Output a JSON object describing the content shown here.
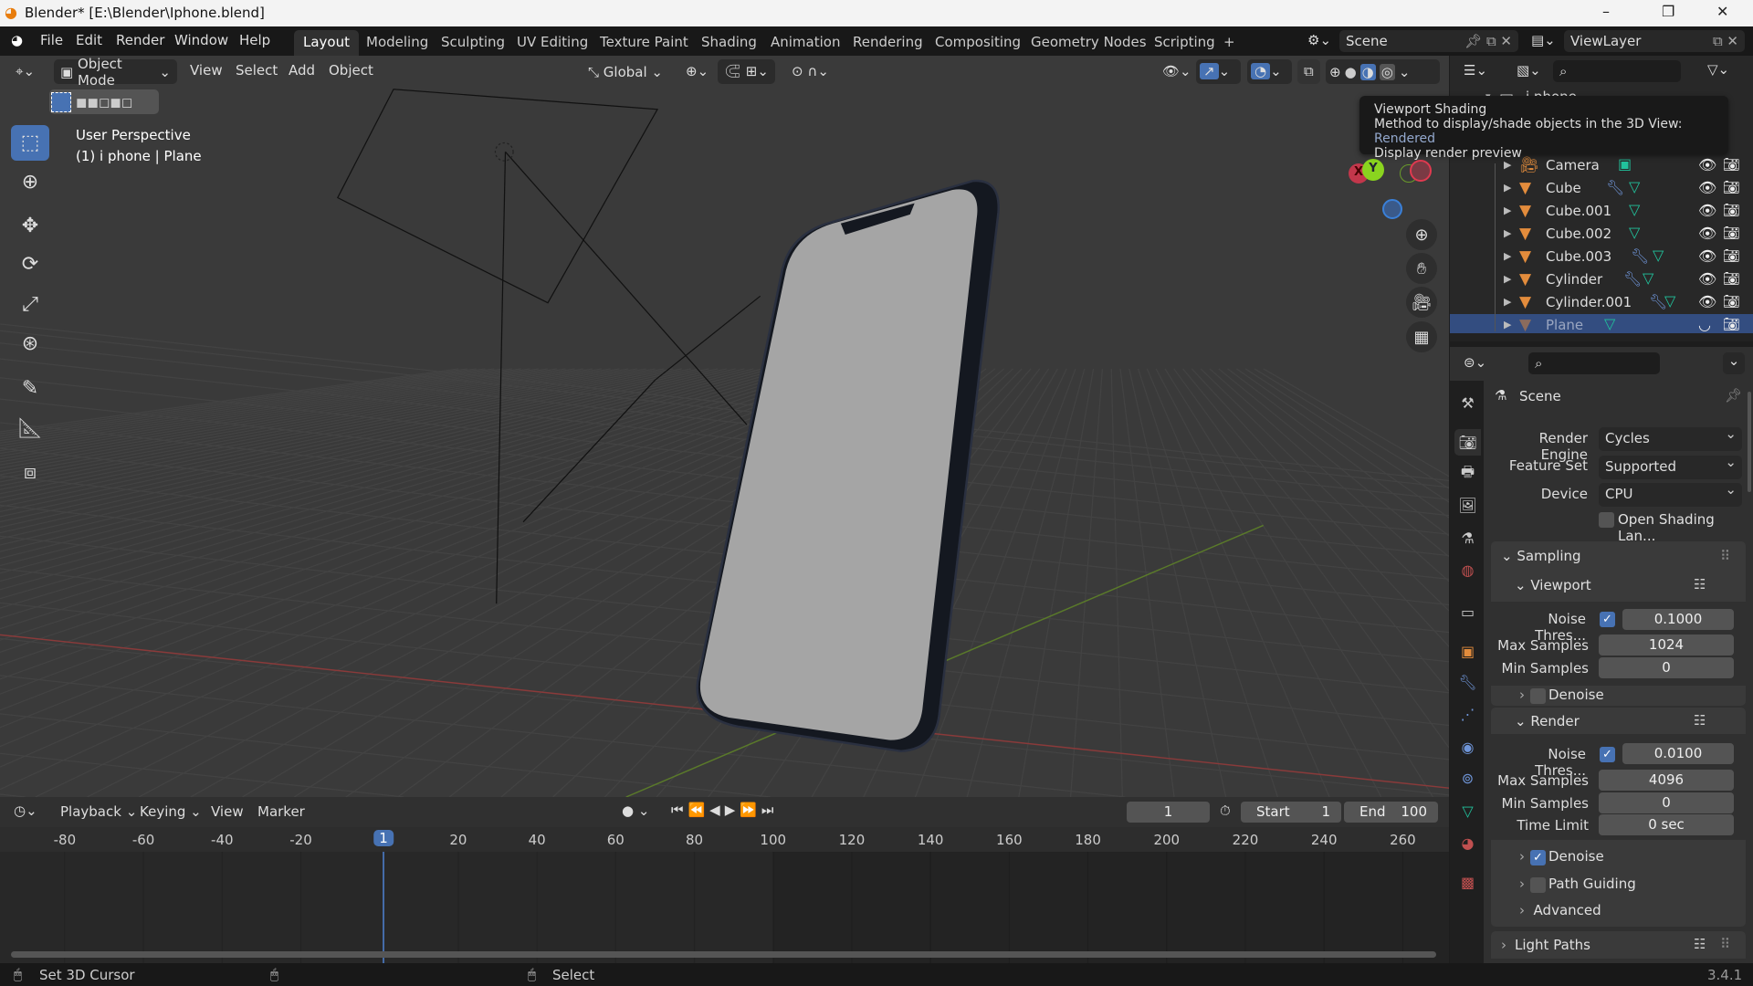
{
  "window": {
    "title": "Blender* [E:\\Blender\\Iphone.blend]",
    "minimize": "–",
    "maximize": "❐",
    "close": "✕"
  },
  "menu": [
    "File",
    "Edit",
    "Render",
    "Window",
    "Help"
  ],
  "workspaces": [
    {
      "label": "Layout",
      "active": true
    },
    {
      "label": "Modeling"
    },
    {
      "label": "Sculpting"
    },
    {
      "label": "UV Editing"
    },
    {
      "label": "Texture Paint"
    },
    {
      "label": "Shading"
    },
    {
      "label": "Animation"
    },
    {
      "label": "Rendering"
    },
    {
      "label": "Compositing"
    },
    {
      "label": "Geometry Nodes"
    },
    {
      "label": "Scripting"
    }
  ],
  "add_workspace": "+",
  "scene": {
    "name": "Scene",
    "view_layer": "ViewLayer"
  },
  "viewport": {
    "mode": "Object Mode",
    "menus": [
      "View",
      "Select",
      "Add",
      "Object"
    ],
    "orientation": "Global",
    "overlay_text": [
      "User Perspective",
      "(1) i phone | Plane"
    ],
    "shading_active": "rendered",
    "gizmo": {
      "x": "X",
      "y": "Y"
    }
  },
  "tooltip": {
    "title": "Viewport Shading",
    "desc": "Method to display/shade objects in the 3D View:",
    "value": "Rendered",
    "detail": "Display render preview"
  },
  "outliner": {
    "collection": "i phone",
    "items": [
      {
        "name": "Camera",
        "type": "camera"
      },
      {
        "name": "Cube",
        "modifier": true
      },
      {
        "name": "Cube.001"
      },
      {
        "name": "Cube.002"
      },
      {
        "name": "Cube.003",
        "modifier": true
      },
      {
        "name": "Cylinder",
        "modifier": true
      },
      {
        "name": "Cylinder.001",
        "modifier": true
      },
      {
        "name": "Plane",
        "selected": true
      }
    ]
  },
  "properties": {
    "context": "Scene",
    "render_engine": {
      "label": "Render Engine",
      "value": "Cycles"
    },
    "feature_set": {
      "label": "Feature Set",
      "value": "Supported"
    },
    "device": {
      "label": "Device",
      "value": "CPU"
    },
    "osl": {
      "label": "Open Shading Lan...",
      "checked": false
    },
    "sampling": {
      "label": "Sampling",
      "viewport": {
        "label": "Viewport",
        "noise_label": "Noise Thres...",
        "noise_checked": true,
        "noise": "0.1000",
        "max_label": "Max Samples",
        "max": "1024",
        "min_label": "Min Samples",
        "min": "0",
        "denoise_label": "Denoise",
        "denoise": false
      },
      "render": {
        "label": "Render",
        "noise_label": "Noise Thres...",
        "noise_checked": true,
        "noise": "0.0100",
        "max_label": "Max Samples",
        "max": "4096",
        "min_label": "Min Samples",
        "min": "0",
        "time_label": "Time Limit",
        "time": "0 sec",
        "denoise_label": "Denoise",
        "denoise": true
      },
      "path_guiding": {
        "label": "Path Guiding",
        "checked": false
      },
      "advanced": "Advanced"
    },
    "light_paths": "Light Paths"
  },
  "timeline": {
    "menus": [
      "Playback",
      "Keying",
      "View",
      "Marker"
    ],
    "current_frame": "1",
    "start_label": "Start",
    "start": "1",
    "end_label": "End",
    "end": "100",
    "ticks": [
      "-80",
      "-60",
      "-40",
      "-20",
      "1",
      "20",
      "40",
      "60",
      "80",
      "100",
      "120",
      "140",
      "160",
      "180",
      "200",
      "220",
      "240",
      "260"
    ]
  },
  "status": {
    "left": "Set 3D Cursor",
    "mid": "Select",
    "version": "3.4.1"
  },
  "colors": {
    "accent": "#4772b3",
    "object": "#e38c3c",
    "mesh": "#21c29c",
    "modifier": "#6f95d8"
  }
}
